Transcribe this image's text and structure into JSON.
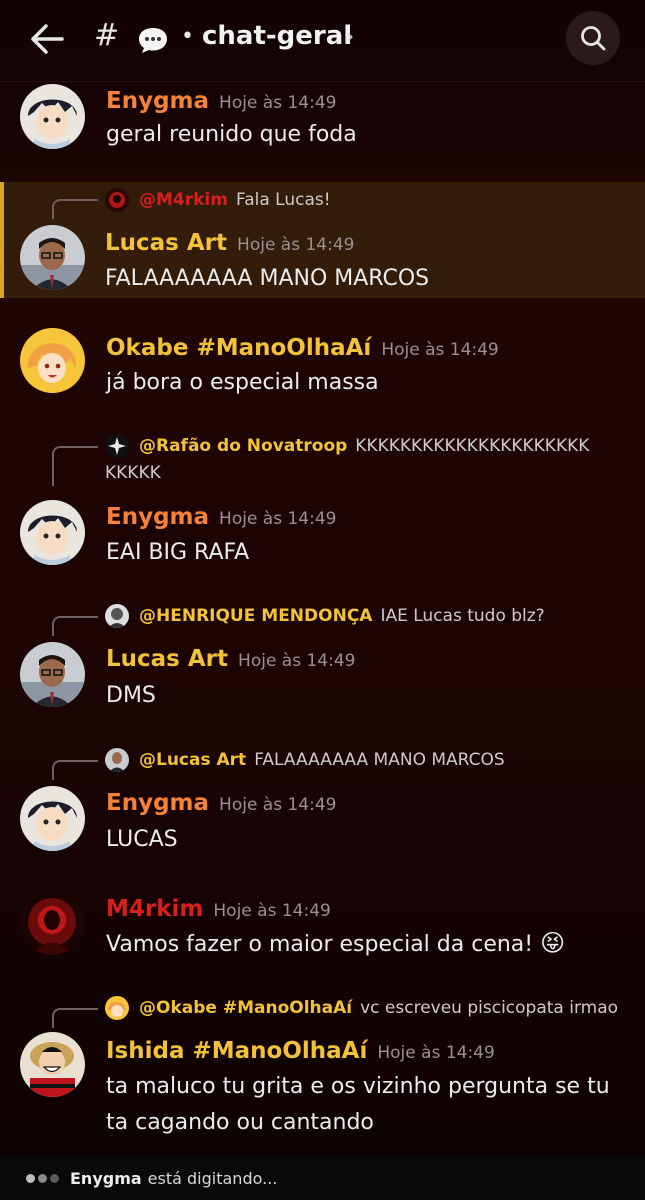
{
  "header": {
    "back_icon": "arrow-left-icon",
    "hash": "#",
    "channel_icon": "speech-bubble-icon",
    "separator": "•",
    "channel": "chat-geral",
    "chevron": "›",
    "search_icon": "search-icon"
  },
  "colors": {
    "enygma": "#f5823b",
    "lucas": "#f2c23a",
    "okabe": "#f2c23a",
    "m4rkim": "#d91e1e",
    "ishida": "#f2c23a",
    "henrique": "#f2c23a",
    "rafao": "#f2c23a",
    "highlight_bar": "#d8a326"
  },
  "messages": [
    {
      "author": "Enygma",
      "time": "Hoje às 14:49",
      "text": "geral reunido que foda"
    },
    {
      "reply_user": "@M4rkim",
      "reply_text": "Fala Lucas!",
      "author": "Lucas Art",
      "time": "Hoje às 14:49",
      "text": "FALAAAAAAA MANO MARCOS"
    },
    {
      "author": "Okabe #ManoOlhaAí",
      "time": "Hoje às 14:49",
      "text": "já bora o especial massa"
    },
    {
      "reply_user": "@Rafão do Novatroop",
      "reply_text": "KKKKKKKKKKKKKKKKKKKKK",
      "reply_text_2": "KKKKK",
      "author": "Enygma",
      "time": "Hoje às 14:49",
      "text": "EAI BIG RAFA"
    },
    {
      "reply_user": "@HENRIQUE MENDONÇA",
      "reply_text": "IAE Lucas tudo blz?",
      "author": "Lucas Art",
      "time": "Hoje às 14:49",
      "text": "DMS"
    },
    {
      "reply_user": "@Lucas Art",
      "reply_text": "FALAAAAAAA MANO MARCOS",
      "author": "Enygma",
      "time": "Hoje às 14:49",
      "text": "LUCAS"
    },
    {
      "author": "M4rkim",
      "time": "Hoje às 14:49",
      "text": "Vamos fazer o maior especial da cena!",
      "emoji": "😝"
    },
    {
      "reply_user": "@Okabe #ManoOlhaAí",
      "reply_text": "vc escreveu piscicopata irmao",
      "author": "Ishida #ManoOlhaAí",
      "time": "Hoje às 14:49",
      "text": "ta maluco tu grita e os vizinho pergunta se tu",
      "text_2": "ta cagando ou cantando"
    }
  ],
  "typing": {
    "user": "Enygma",
    "text": "está digitando..."
  }
}
